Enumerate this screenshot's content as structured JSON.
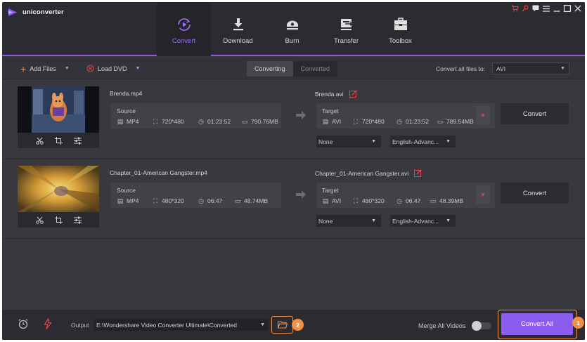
{
  "app": {
    "name": "uniconverter"
  },
  "window_controls": [
    "cart-icon",
    "key-icon",
    "chat-icon",
    "menu-icon",
    "minimize-icon",
    "maximize-icon",
    "close-icon"
  ],
  "nav": [
    {
      "label": "Convert",
      "icon": "convert-icon",
      "active": true
    },
    {
      "label": "Download",
      "icon": "download-icon",
      "active": false
    },
    {
      "label": "Burn",
      "icon": "burn-icon",
      "active": false
    },
    {
      "label": "Transfer",
      "icon": "transfer-icon",
      "active": false
    },
    {
      "label": "Toolbox",
      "icon": "toolbox-icon",
      "active": false
    }
  ],
  "toolbar": {
    "add_files": "Add Files",
    "load_dvd": "Load DVD",
    "tabs": [
      "Converting",
      "Converted"
    ],
    "active_tab": "Converting",
    "convert_all_to_label": "Convert all files to:",
    "convert_all_to_value": "AVI"
  },
  "files": [
    {
      "name": "Brenda.mp4",
      "source": {
        "title": "Source",
        "format": "MP4",
        "resolution": "720*480",
        "duration": "01:23:52",
        "size": "790.76MB"
      },
      "target_name": "Brenda.avi",
      "target": {
        "title": "Target",
        "format": "AVI",
        "resolution": "720*480",
        "duration": "01:23:52",
        "size": "789.54MB"
      },
      "subtitle": "None",
      "audio": "English-Advanc...",
      "convert_label": "Convert"
    },
    {
      "name": "Chapter_01-American Gangster.mp4",
      "source": {
        "title": "Source",
        "format": "MP4",
        "resolution": "480*320",
        "duration": "06:47",
        "size": "48.74MB"
      },
      "target_name": "Chapter_01-American Gangster.avi",
      "target": {
        "title": "Target",
        "format": "AVI",
        "resolution": "480*320",
        "duration": "06:47",
        "size": "48.39MB"
      },
      "subtitle": "None",
      "audio": "English-Advanc...",
      "convert_label": "Convert"
    }
  ],
  "bottom": {
    "output_label": "Output",
    "output_path": "E:\\Wondershare Video Converter Ultimate\\Converted",
    "folder_badge": "2",
    "merge_label": "Merge All Videos",
    "merge_enabled": false,
    "convert_all_label": "Convert All",
    "convert_all_badge": "1"
  },
  "colors": {
    "accent": "#8b5cf0",
    "highlight": "#f0914a",
    "danger": "#e0454c"
  }
}
